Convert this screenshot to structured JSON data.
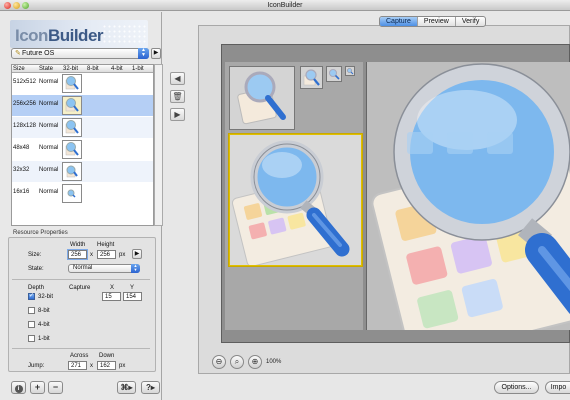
{
  "window": {
    "title": "IconBuilder"
  },
  "logo": {
    "text_light": "Icon",
    "text_bold": "Builder"
  },
  "os_select": {
    "value": "Future OS"
  },
  "table": {
    "headers": [
      "Size",
      "State",
      "32-bit",
      "8-bit",
      "4-bit",
      "1-bit"
    ],
    "rows": [
      {
        "size": "512x512",
        "state": "Normal"
      },
      {
        "size": "256x256",
        "state": "Normal"
      },
      {
        "size": "128x128",
        "state": "Normal"
      },
      {
        "size": "48x48",
        "state": "Normal"
      },
      {
        "size": "32x32",
        "state": "Normal"
      },
      {
        "size": "16x16",
        "state": "Normal"
      }
    ],
    "selected_index": 1
  },
  "resource": {
    "title": "Resource Properties",
    "size_label": "Size:",
    "width_label": "Width",
    "height_label": "Height",
    "width": "256",
    "x_sep": "x",
    "height": "256",
    "unit": "px",
    "state_label": "State:",
    "state_value": "Normal",
    "depth_label": "Depth",
    "capture_label": "Capture",
    "x_label": "X",
    "y_label": "Y",
    "depths": [
      {
        "label": "32-bit",
        "checked": true
      },
      {
        "label": "8-bit",
        "checked": false
      },
      {
        "label": "4-bit",
        "checked": false
      },
      {
        "label": "1-bit",
        "checked": false
      }
    ],
    "capture_x": "15",
    "capture_y": "154",
    "jump_label": "Jump:",
    "across_label": "Across",
    "down_label": "Down",
    "across": "271",
    "down": "162"
  },
  "tabs": {
    "items": [
      "Capture",
      "Preview",
      "Verify"
    ],
    "active": "Capture"
  },
  "zoom": {
    "level": "100%"
  },
  "buttons": {
    "options": "Options...",
    "import": "Impo"
  },
  "icons": {
    "info": "info-icon",
    "add": "plus-icon",
    "remove": "minus-icon",
    "command": "command-menu-icon",
    "help": "help-menu-icon",
    "left": "arrow-left-icon",
    "trash": "trash-icon",
    "right": "arrow-right-icon"
  },
  "colors": {
    "selection": "#b5cff5",
    "accent": "#4d8fe4",
    "lens": "#7db8ee",
    "handle": "#2f6fd0"
  }
}
